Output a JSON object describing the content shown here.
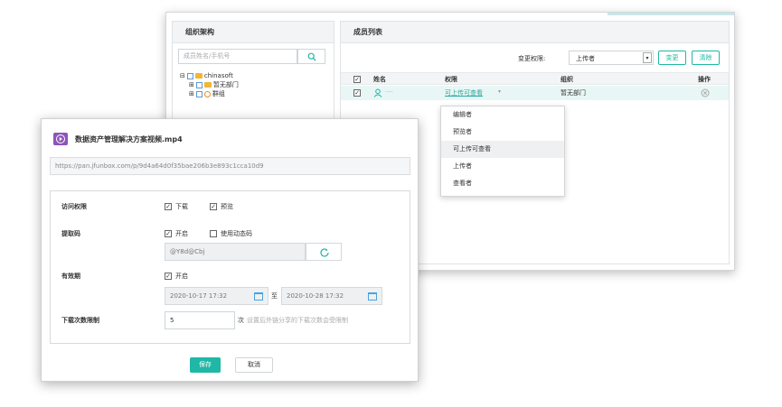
{
  "org_panel": {
    "title": "组织架构",
    "search_placeholder": "成员姓名/手机号",
    "tree": [
      {
        "expander": "⊟",
        "label": "chinasoft"
      },
      {
        "expander": "⊞",
        "label": "暂无部门"
      },
      {
        "expander": "⊞",
        "label": "群组"
      }
    ]
  },
  "member_panel": {
    "title": "成员列表",
    "change_permission_label": "变更权限:",
    "permission_select_value": "上传者",
    "change_button": "变更",
    "clear_button": "清除",
    "columns": [
      "姓名",
      "权限",
      "组织",
      "操作"
    ],
    "rows": [
      {
        "name": "····",
        "permission": "可上传可查看",
        "org": "暂无部门"
      }
    ]
  },
  "permission_dropdown": {
    "options": [
      "编辑者",
      "预览者",
      "可上传可查看",
      "上传者",
      "查看者"
    ],
    "active_index": 2
  },
  "dialog": {
    "title": "数据资产管理解决方案视频.mp4",
    "share_link": "https://pan.jfunbox.com/p/9d4a64d0f35bae206b3e893c1cca10d9",
    "access_label": "访问权限",
    "access_download": "下载",
    "access_preview": "预览",
    "code_label": "提取码",
    "code_enable": "开启",
    "code_dynamic": "使用动态码",
    "code_value": "@Y8d@Cbj",
    "validity_label": "有效期",
    "validity_enable": "开启",
    "date_start": "2020-10-17 17:32",
    "date_to": "至",
    "date_end": "2020-10-28 17:32",
    "download_limit_label": "下载次数限制",
    "download_limit_value": "5",
    "download_limit_unit": "次",
    "download_limit_hint": "设置后外链分享的下载次数会受限制",
    "save_button": "保存",
    "cancel_button": "取消"
  },
  "colors": {
    "accent": "#1fb7a6",
    "link": "#2aa8a0",
    "video_icon": "#8e54b8"
  }
}
